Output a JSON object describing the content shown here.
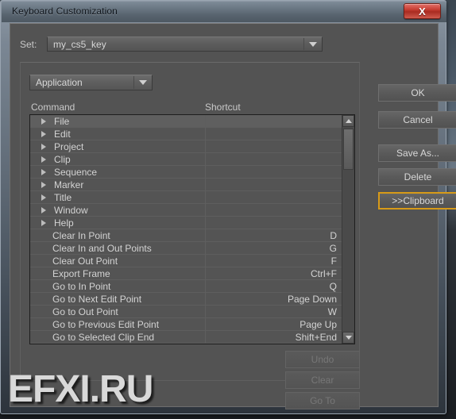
{
  "window": {
    "title": "Keyboard Customization",
    "close_label": "X",
    "close_icon": "close-icon"
  },
  "set_row": {
    "label": "Set:",
    "value": "my_cs5_key",
    "dropdown_icon": "chevron-down-icon"
  },
  "category_combo": {
    "value": "Application",
    "dropdown_icon": "chevron-down-icon"
  },
  "columns": {
    "command": "Command",
    "shortcut": "Shortcut"
  },
  "rows": [
    {
      "command": "File",
      "shortcut": "",
      "group": true,
      "selected": true
    },
    {
      "command": "Edit",
      "shortcut": "",
      "group": true,
      "selected": false
    },
    {
      "command": "Project",
      "shortcut": "",
      "group": true,
      "selected": false
    },
    {
      "command": "Clip",
      "shortcut": "",
      "group": true,
      "selected": false
    },
    {
      "command": "Sequence",
      "shortcut": "",
      "group": true,
      "selected": false
    },
    {
      "command": "Marker",
      "shortcut": "",
      "group": true,
      "selected": false
    },
    {
      "command": "Title",
      "shortcut": "",
      "group": true,
      "selected": false
    },
    {
      "command": "Window",
      "shortcut": "",
      "group": true,
      "selected": false
    },
    {
      "command": "Help",
      "shortcut": "",
      "group": true,
      "selected": false
    },
    {
      "command": "Clear In Point",
      "shortcut": "D",
      "group": false,
      "selected": false
    },
    {
      "command": "Clear In and Out Points",
      "shortcut": "G",
      "group": false,
      "selected": false
    },
    {
      "command": "Clear Out Point",
      "shortcut": "F",
      "group": false,
      "selected": false
    },
    {
      "command": "Export Frame",
      "shortcut": "Ctrl+F",
      "group": false,
      "selected": false
    },
    {
      "command": "Go to In Point",
      "shortcut": "Q",
      "group": false,
      "selected": false
    },
    {
      "command": "Go to Next Edit Point",
      "shortcut": "Page Down",
      "group": false,
      "selected": false
    },
    {
      "command": "Go to Out Point",
      "shortcut": "W",
      "group": false,
      "selected": false
    },
    {
      "command": "Go to Previous Edit Point",
      "shortcut": "Page Up",
      "group": false,
      "selected": false
    },
    {
      "command": "Go to Selected Clip End",
      "shortcut": "Shift+End",
      "group": false,
      "selected": false
    }
  ],
  "scrollbar": {
    "up_icon": "triangle-up-icon",
    "down_icon": "triangle-down-icon"
  },
  "side_buttons": {
    "ok": "OK",
    "cancel": "Cancel",
    "save_as": "Save As...",
    "delete": "Delete",
    "clipboard": ">>Clipboard"
  },
  "bottom_buttons": {
    "undo": "Undo",
    "clear": "Clear",
    "go_to": "Go To"
  },
  "watermark": {
    "text": "EFXI.RU"
  },
  "colors": {
    "dialog_bg": "#535353",
    "list_bg": "#545454",
    "text": "#d3d3d3",
    "focus_accent": "#d79a18",
    "close_red": "#c83f34",
    "disabled_text": "#777777"
  }
}
